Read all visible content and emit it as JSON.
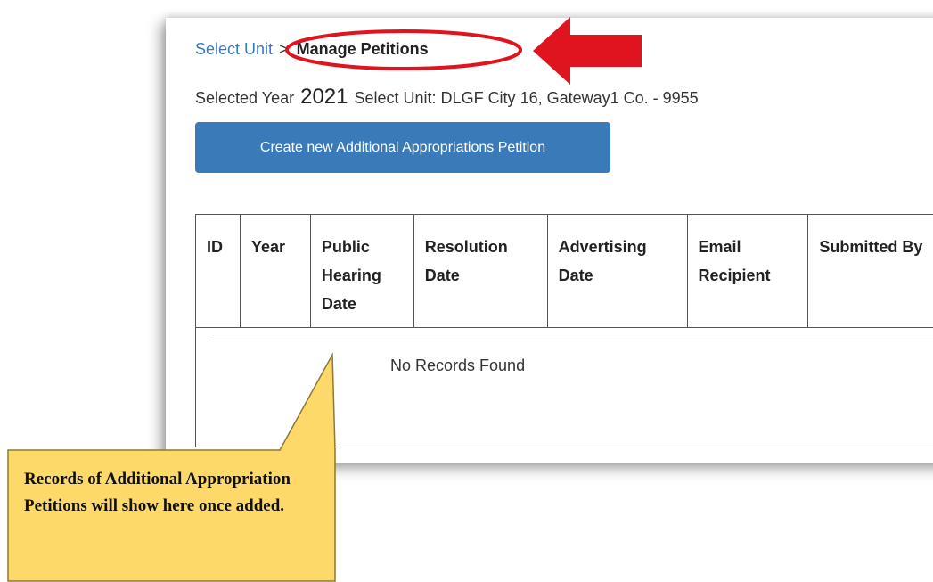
{
  "breadcrumb": {
    "link_label": "Select Unit",
    "separator": ">",
    "current_label": "Manage Petitions"
  },
  "selection": {
    "prefix": "Selected Year",
    "year": "2021",
    "unit_text": "Select Unit: DLGF City 16, Gateway1 Co. - 9955"
  },
  "actions": {
    "create_label": "Create new Additional Appropriations Petition"
  },
  "table": {
    "columns": [
      {
        "label": "ID"
      },
      {
        "label": "Year"
      },
      {
        "label": "Public Hearing Date"
      },
      {
        "label": "Resolution Date"
      },
      {
        "label": "Advertising Date"
      },
      {
        "label": "Email Recipient"
      },
      {
        "label": "Submitted By"
      }
    ],
    "empty_message": "No Records Found"
  },
  "annotation": {
    "callout_text": "Records of Additional Appropriation Petitions will show here once added.",
    "highlight_color": "#e0141e",
    "callout_fill": "#fdd96a",
    "accent": "#3a7ab8"
  }
}
